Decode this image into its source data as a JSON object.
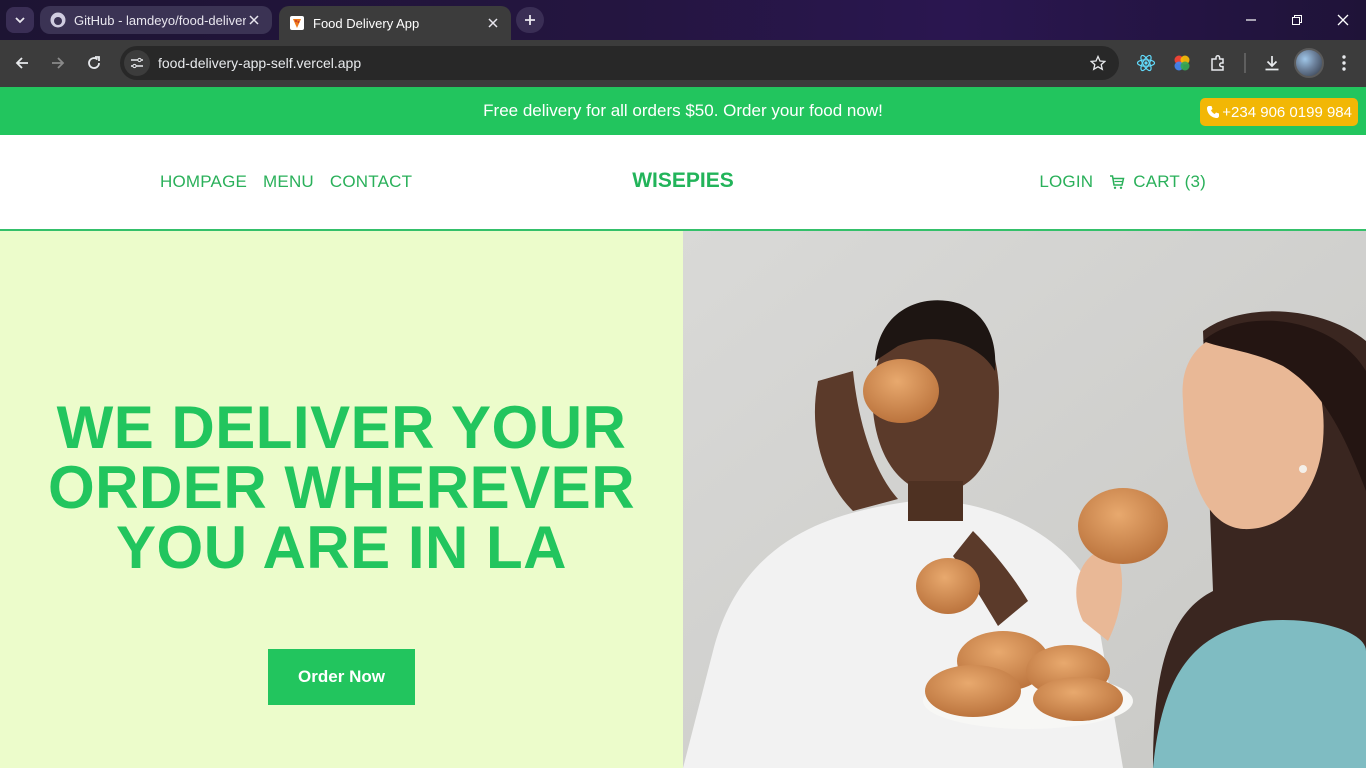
{
  "browser": {
    "tabs": [
      {
        "title": "GitHub - lamdeyo/food-delivery-app",
        "active": false,
        "icon": "github-icon"
      },
      {
        "title": "Food Delivery App",
        "active": true,
        "icon": "pizza-icon"
      }
    ],
    "url": "food-delivery-app-self.vercel.app"
  },
  "promo": {
    "text": "Free delivery for all orders $50. Order your food now!",
    "phone": "+234 906 0199 984"
  },
  "nav": {
    "links": [
      "HOMPAGE",
      "MENU",
      "CONTACT"
    ],
    "logo": "WISEPIES",
    "login": "LOGIN",
    "cart": "CART (3)"
  },
  "hero": {
    "title": "WE DELIVER YOUR ORDER WHEREVER YOU ARE IN LA",
    "button": "Order Now",
    "image_alt": "two women eating burgers"
  },
  "colors": {
    "brand_green": "#22c55e",
    "hero_bg": "#ecfccb",
    "phone_badge": "#f2b705"
  }
}
